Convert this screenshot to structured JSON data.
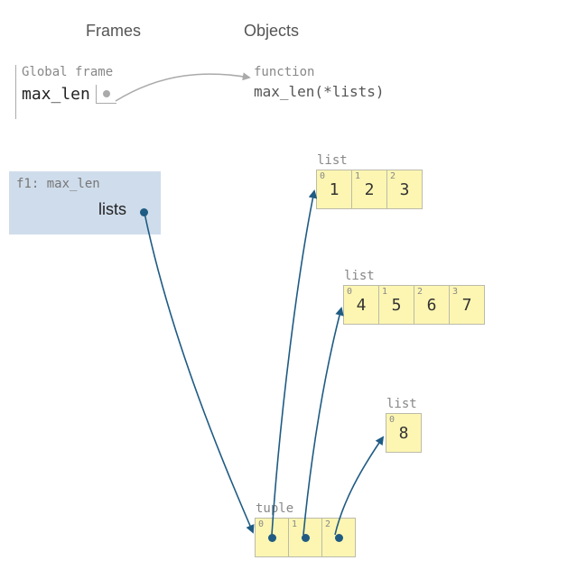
{
  "headers": {
    "frames": "Frames",
    "objects": "Objects"
  },
  "global_frame": {
    "title": "Global frame",
    "var": "max_len"
  },
  "f1_frame": {
    "title": "f1: max_len",
    "var": "lists"
  },
  "function": {
    "label": "function",
    "signature": "max_len(*lists)"
  },
  "lists": [
    {
      "label": "list",
      "items": [
        "1",
        "2",
        "3"
      ]
    },
    {
      "label": "list",
      "items": [
        "4",
        "5",
        "6",
        "7"
      ]
    },
    {
      "label": "list",
      "items": [
        "8"
      ]
    }
  ],
  "tuple": {
    "label": "tuple",
    "slots": 3
  },
  "chart_data": {
    "type": "diagram",
    "note": "Python Tutor style environment diagram",
    "frames": [
      {
        "name": "Global frame",
        "bindings": {
          "max_len": "→ function max_len(*lists)"
        }
      },
      {
        "name": "f1: max_len",
        "bindings": {
          "lists": "→ tuple(→list[1,2,3], →list[4,5,6,7], →list[8])"
        }
      }
    ],
    "objects": [
      {
        "type": "function",
        "repr": "max_len(*lists)"
      },
      {
        "type": "list",
        "value": [
          1,
          2,
          3
        ]
      },
      {
        "type": "list",
        "value": [
          4,
          5,
          6,
          7
        ]
      },
      {
        "type": "list",
        "value": [
          8
        ]
      },
      {
        "type": "tuple",
        "value": [
          "ref_list0",
          "ref_list1",
          "ref_list2"
        ]
      }
    ]
  }
}
